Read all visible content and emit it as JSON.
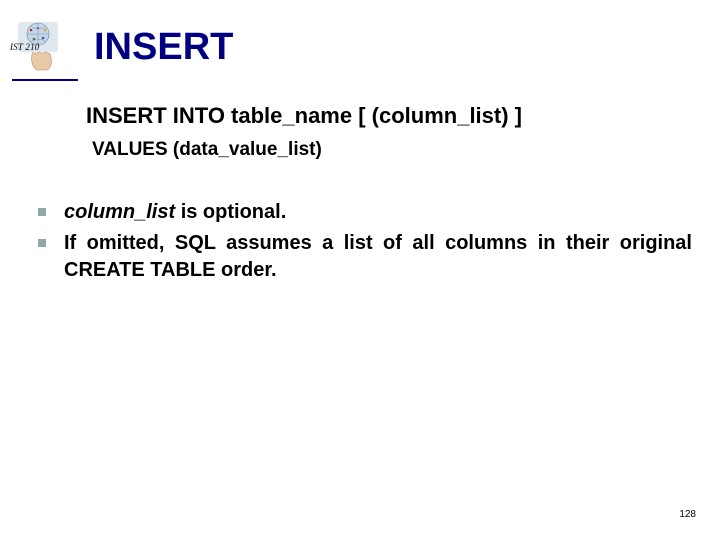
{
  "header": {
    "course_label": "IST 210",
    "title": "INSERT"
  },
  "syntax": {
    "line1": "INSERT INTO table_name [ (column_list) ]",
    "line2": "VALUES (data_value_list)"
  },
  "bullets": [
    {
      "em": "column_list",
      "rest": " is optional."
    },
    {
      "em": "",
      "rest": "If omitted, SQL assumes a list of all columns in their original CREATE TABLE order."
    }
  ],
  "page_number": "128",
  "colors": {
    "title_navy": "#000080",
    "bullet_square": "#8fa8a8"
  }
}
